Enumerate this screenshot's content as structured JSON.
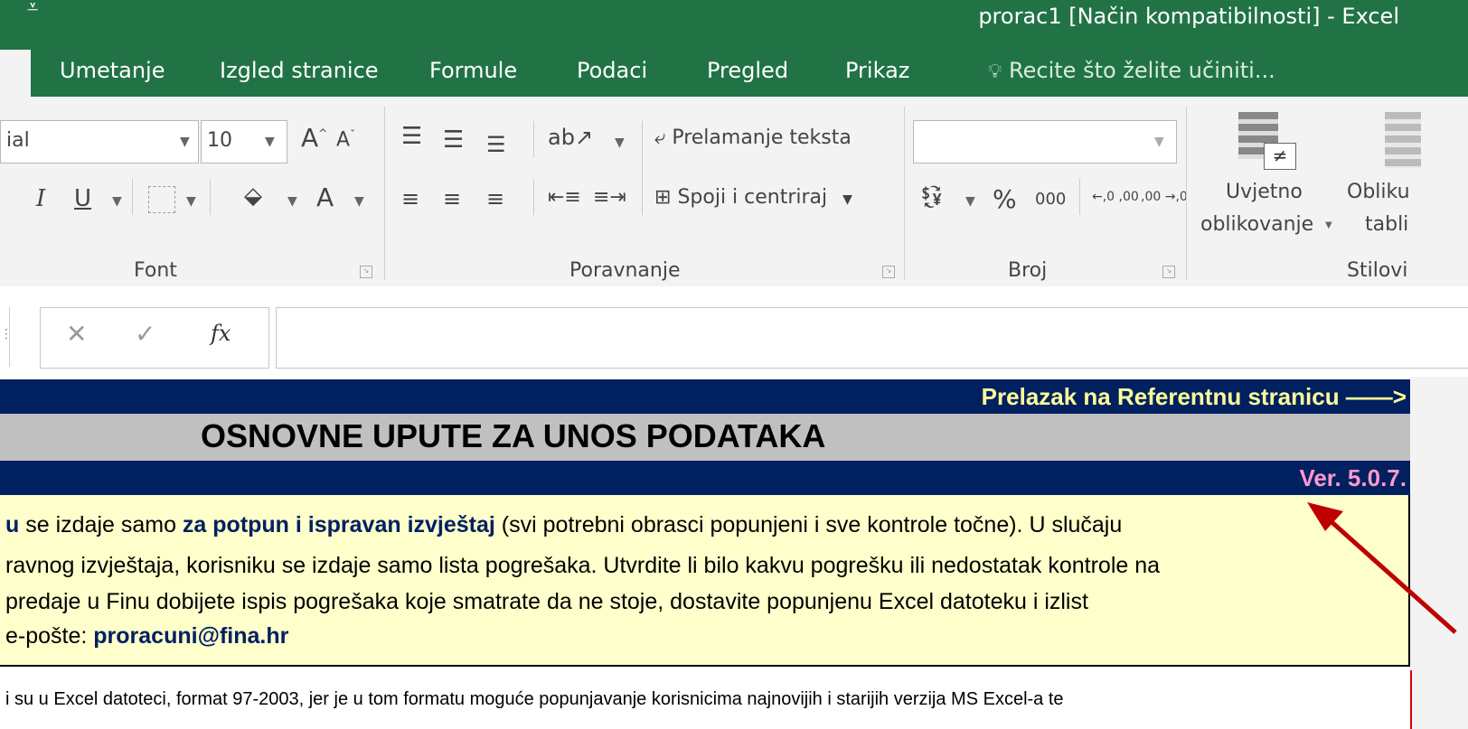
{
  "window": {
    "title": "prorac1  [Način kompatibilnosti] - Excel"
  },
  "ribbon_tabs": [
    "Umetanje",
    "Izgled stranice",
    "Formule",
    "Podaci",
    "Pregled",
    "Prikaz"
  ],
  "tell_me": "Recite što želite učiniti...",
  "font_group": {
    "font_name": "ial",
    "font_size": "10",
    "grow": "A",
    "shrink": "A",
    "italic": "I",
    "underline": "U",
    "font_color": "A",
    "label": "Font"
  },
  "alignment_group": {
    "wrap_text": "Prelamanje teksta",
    "merge_center": "Spoji i centriraj",
    "label": "Poravnanje"
  },
  "number_group": {
    "percent": "%",
    "thousands": "000",
    "inc_decimal": "←,0 ,00",
    "dec_decimal": ",00 →,0",
    "label": "Broj"
  },
  "styles_group": {
    "conditional_1": "Uvjetno",
    "conditional_2": "oblikovanje",
    "table_1": "Obliku",
    "table_2": "tabli",
    "label": "Stilovi"
  },
  "formula_bar": {
    "cancel": "✕",
    "enter": "✓",
    "fx": "fx",
    "value": ""
  },
  "sheet": {
    "nav_link": "Prelazak na Referentnu stranicu ——>",
    "heading": "OSNOVNE UPUTE ZA UNOS PODATAKA",
    "version": "Ver. 5.0.7.",
    "line1_a": "u",
    "line1_b": " se izdaje samo ",
    "line1_c": "za potpun i ispravan izvještaj",
    "line1_d": " (svi potrebni obrasci popunjeni i sve kontrole točne). U slučaju",
    "line2": "ravnog izvještaja, korisniku se izdaje samo lista pogrešaka. Utvrdite li bilo kakvu pogrešku ili nedostatak kontrole na",
    "line3": " predaje u Finu dobijete ispis pogrešaka koje smatrate da ne stoje, dostavite popunjenu Excel datoteku i izlist",
    "line4_a": "e-pošte: ",
    "line4_b": "proracuni@fina.hr",
    "bottom": "i su u Excel datoteci, format 97-2003, jer je u tom formatu moguće popunjavanje korisnicima najnovijih i starijih verzija MS Excel-a te"
  },
  "colors": {
    "excel_green": "#217346",
    "navy": "#002060",
    "link_yellow": "#ffff99",
    "version_pink": "#ff99cc",
    "note_yellow": "#ffffcc",
    "arrow_red": "#c00000"
  }
}
